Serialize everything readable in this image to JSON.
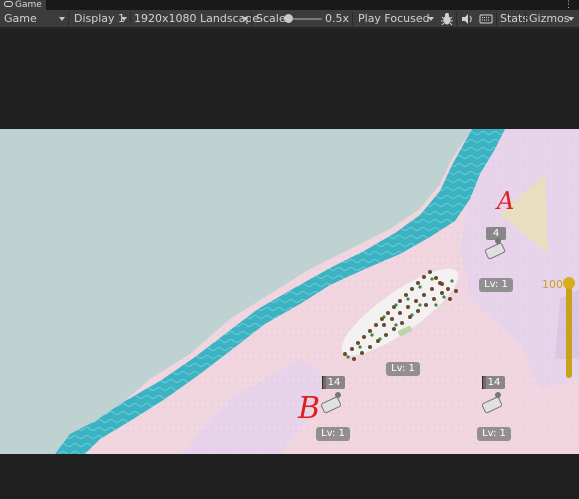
{
  "tab": {
    "label": "Game",
    "icon": "gamepad-icon",
    "menu_icon": "more-dots-icon"
  },
  "toolbar": {
    "display_mode": "Game",
    "display": "Display 1",
    "resolution": "1920x1080 Landscape",
    "scale_label": "Scale",
    "scale_value": "0.5x",
    "play_mode": "Play Focused",
    "stats_label": "Stats",
    "gizmos_label": "Gizmos"
  },
  "game": {
    "annotation_a": "A",
    "annotation_b": "B",
    "slider_value": "100",
    "towers": [
      {
        "id": "a",
        "count": "4",
        "level": "Lv: 1"
      },
      {
        "id": "mid",
        "count": "",
        "level": "Lv: 1"
      },
      {
        "id": "b",
        "count": "14",
        "level": "Lv: 1"
      },
      {
        "id": "right",
        "count": "14",
        "level": "Lv: 1"
      }
    ]
  },
  "colors": {
    "water": "#3cb3c2",
    "fog": "#bfd2d2",
    "ground_pink": "#f1d6e0",
    "ground_lilac": "#e8d4ea",
    "slider": "#d6ad1e",
    "annotation": "#e02020"
  }
}
